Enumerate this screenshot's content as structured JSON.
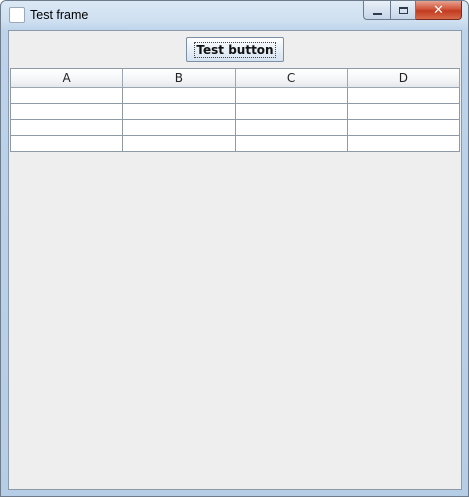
{
  "window": {
    "title": "Test frame",
    "icon": "java-icon",
    "controls": [
      "minimize-icon",
      "maximize-icon",
      "close-icon"
    ],
    "close_glyph": "✕"
  },
  "toolbar": {
    "test_button_label": "Test button"
  },
  "table": {
    "columns": [
      "A",
      "B",
      "C",
      "D"
    ],
    "rows": [
      [
        "",
        "",
        "",
        ""
      ],
      [
        "",
        "",
        "",
        ""
      ],
      [
        "",
        "",
        "",
        ""
      ],
      [
        "",
        "",
        "",
        ""
      ]
    ]
  },
  "colors": {
    "close_button": "#c23b1f",
    "content_background": "#eeeeee",
    "grid_line": "#8e9aa6"
  }
}
